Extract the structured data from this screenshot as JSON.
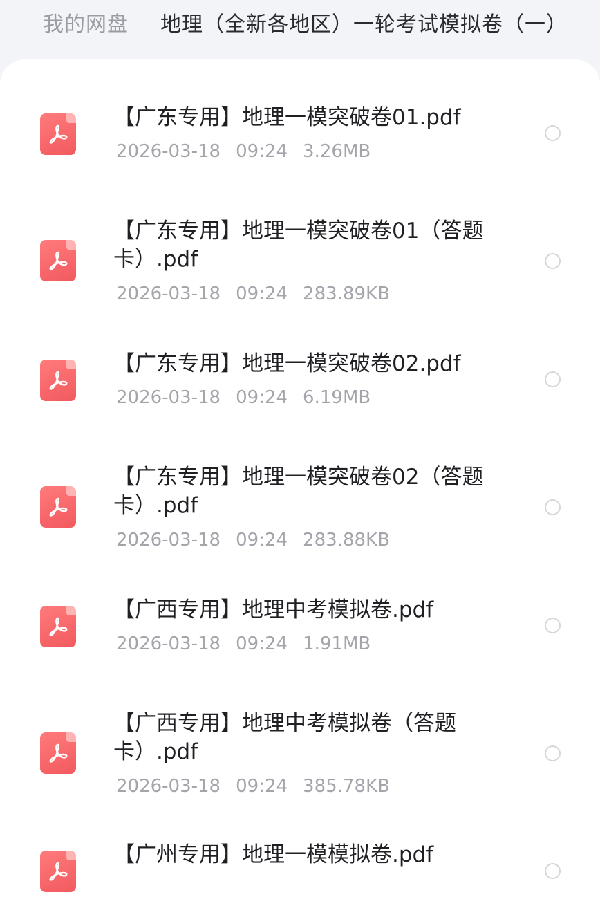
{
  "breadcrumb": {
    "root": "我的网盘",
    "current": "地理（全新各地区）一轮考试模拟卷（一）"
  },
  "files": [
    {
      "name": "【广东专用】地理一模突破卷01.pdf",
      "date": "2026-03-18",
      "time": "09:24",
      "size": "3.26MB"
    },
    {
      "name": "【广东专用】地理一模突破卷01（答题卡）.pdf",
      "date": "2026-03-18",
      "time": "09:24",
      "size": "283.89KB"
    },
    {
      "name": "【广东专用】地理一模突破卷02.pdf",
      "date": "2026-03-18",
      "time": "09:24",
      "size": "6.19MB"
    },
    {
      "name": "【广东专用】地理一模突破卷02（答题卡）.pdf",
      "date": "2026-03-18",
      "time": "09:24",
      "size": "283.88KB"
    },
    {
      "name": "【广西专用】地理中考模拟卷.pdf",
      "date": "2026-03-18",
      "time": "09:24",
      "size": "1.91MB"
    },
    {
      "name": "【广西专用】地理中考模拟卷（答题卡）.pdf",
      "date": "2026-03-18",
      "time": "09:24",
      "size": "385.78KB"
    },
    {
      "name": "【广州专用】地理一模模拟卷.pdf",
      "date": "",
      "time": "",
      "size": ""
    }
  ],
  "icons": {
    "file": "pdf-icon",
    "select": "radio-unchecked"
  },
  "colors": {
    "pdf_icon": "#f25a5f",
    "meta_text": "#a3a5ab",
    "breadcrumb_root": "#9a9ca3"
  }
}
